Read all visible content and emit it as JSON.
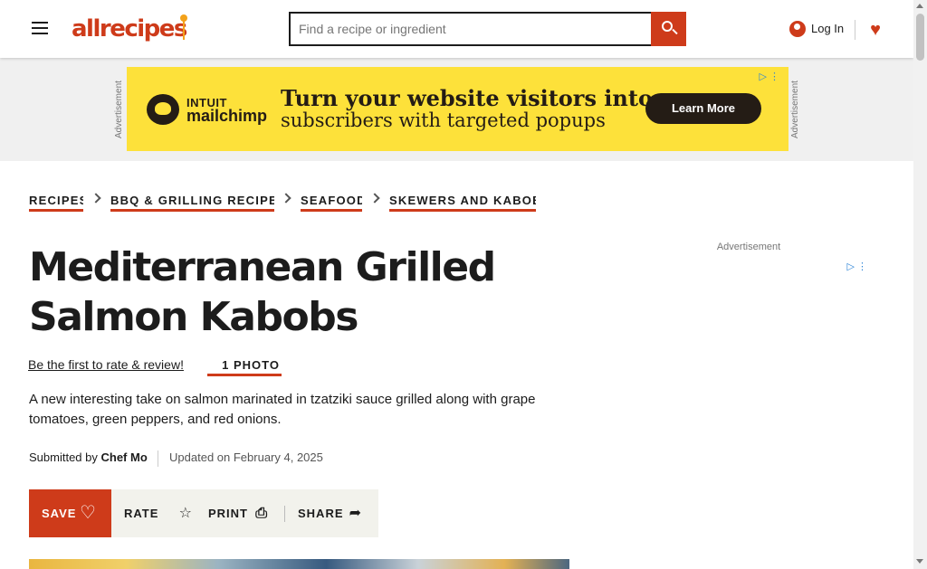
{
  "header": {
    "logo_text": "allrecipes",
    "search": {
      "placeholder": "Find a recipe or ingredient"
    },
    "login_label": "Log In"
  },
  "ad_banner": {
    "side_label": "Advertisement",
    "brand_line1": "INTUIT",
    "brand_line2": "mailchimp",
    "headline_line1": "Turn your website visitors into",
    "headline_line2": "subscribers with targeted popups",
    "cta": "Learn More"
  },
  "breadcrumbs": [
    {
      "label": "RECIPES"
    },
    {
      "label": "BBQ & GRILLING RECIPES"
    },
    {
      "label": "SEAFOOD"
    },
    {
      "label": "SKEWERS AND KABOBS"
    }
  ],
  "recipe": {
    "title": "Mediterranean Grilled Salmon Kabobs",
    "rate_link": "Be the first to rate & review!",
    "photo_link": "1 PHOTO",
    "description": "A new interesting take on salmon marinated in tzatziki sauce grilled along with grape tomatoes, green peppers, and red onions.",
    "submitted_by_prefix": "Submitted by",
    "author": "Chef Mo",
    "updated": "Updated on February 4, 2025"
  },
  "actions": {
    "save": "SAVE",
    "rate": "RATE",
    "print": "PRINT",
    "share": "SHARE"
  },
  "right_rail": {
    "ad_label": "Advertisement"
  },
  "icons": {
    "search": "search-icon",
    "user": "user-icon",
    "heart": "heart-icon",
    "star": "star-icon",
    "print": "printer-icon",
    "share": "share-icon",
    "ad_choices": "ad-choices-icon"
  },
  "colors": {
    "brand": "#ce3b1a",
    "ad_background": "#fde13a",
    "action_bar": "#f2f2ec"
  }
}
